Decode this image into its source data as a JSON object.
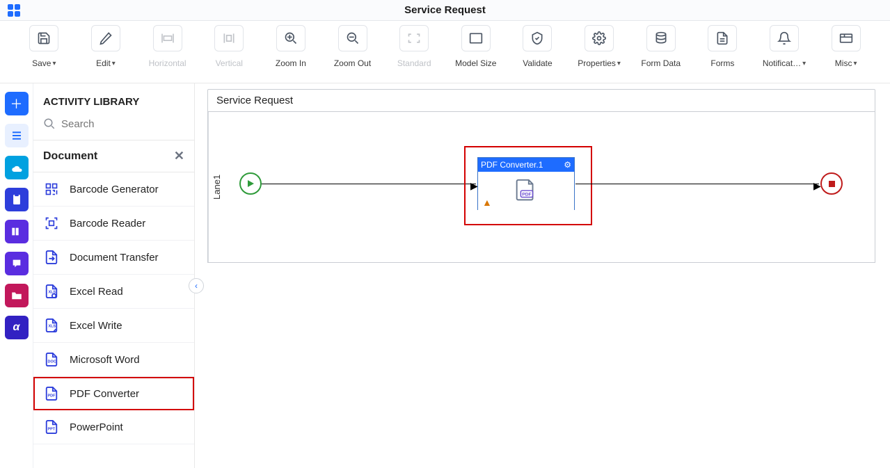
{
  "title": "Service Request",
  "toolbar": {
    "save": "Save",
    "edit": "Edit",
    "horizontal": "Horizontal",
    "vertical": "Vertical",
    "zoom_in": "Zoom In",
    "zoom_out": "Zoom Out",
    "standard": "Standard",
    "model_size": "Model Size",
    "validate": "Validate",
    "properties": "Properties",
    "form_data": "Form Data",
    "forms": "Forms",
    "notifications": "Notificat…",
    "misc": "Misc"
  },
  "sidebar": {
    "heading": "ACTIVITY LIBRARY",
    "search_placeholder": "Search",
    "category": "Document",
    "items": [
      {
        "label": "Barcode Generator"
      },
      {
        "label": "Barcode Reader"
      },
      {
        "label": "Document Transfer"
      },
      {
        "label": "Excel Read"
      },
      {
        "label": "Excel Write"
      },
      {
        "label": "Microsoft Word"
      },
      {
        "label": "PDF Converter"
      },
      {
        "label": "PowerPoint"
      }
    ]
  },
  "canvas": {
    "title": "Service Request",
    "lane_label": "Lane1",
    "activity": {
      "title": "PDF Converter.1",
      "badge": "PDF"
    }
  }
}
